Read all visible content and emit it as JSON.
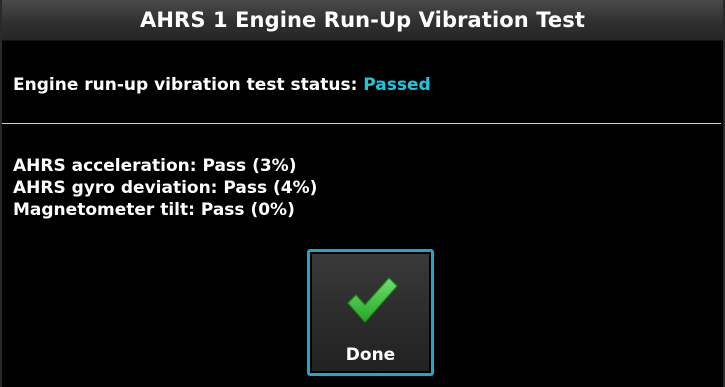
{
  "dialog": {
    "title": "AHRS 1 Engine Run-Up Vibration Test"
  },
  "status": {
    "label": "Engine run-up vibration test status:",
    "value": "Passed",
    "value_color": "#1ec8dc"
  },
  "results": [
    {
      "text": "AHRS acceleration: Pass (3%)"
    },
    {
      "text": "AHRS gyro deviation: Pass (4%)"
    },
    {
      "text": "Magnetometer tilt: Pass (0%)"
    }
  ],
  "done_button": {
    "label": "Done",
    "icon": "checkmark-icon",
    "border_color": "#1ea8c8",
    "icon_color": "#3cc83c"
  }
}
